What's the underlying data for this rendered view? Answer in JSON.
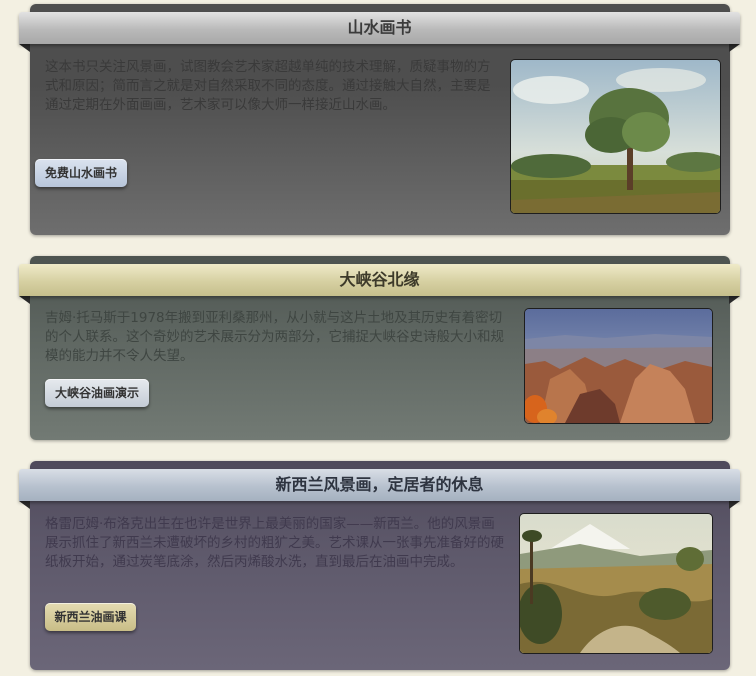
{
  "cards": [
    {
      "title": "山水画书",
      "description": "这本书只关注风景画，试图教会艺术家超越单纯的技术理解，质疑事物的方式和原因；简而言之就是对自然采取不同的态度。通过接触大自然，主要是通过定期在外面画画，艺术家可以像大师一样接近山水画。",
      "button_label": "免费山水画书",
      "image_icon": "landscape-painting"
    },
    {
      "title": "大峡谷北缘",
      "description": "吉姆·托马斯于1978年搬到亚利桑那州，从小就与这片土地及其历史有着密切的个人联系。这个奇妙的艺术展示分为两部分，它捕捉大峡谷史诗般大小和规模的能力并不令人失望。",
      "button_label": "大峡谷油画演示",
      "image_icon": "canyon-painting"
    },
    {
      "title": "新西兰风景画，定居者的休息",
      "description": "格雷厄姆·布洛克出生在也许是世界上最美丽的国家——新西兰。他的风景画展示抓住了新西兰未遭破坏的乡村的粗犷之美。艺术课从一张事先准备好的硬纸板开始，通过炭笔底涂，然后丙烯酸水洗，直到最后在油画中完成。",
      "button_label": "新西兰油画课",
      "image_icon": "new-zealand-landscape-painting"
    }
  ]
}
